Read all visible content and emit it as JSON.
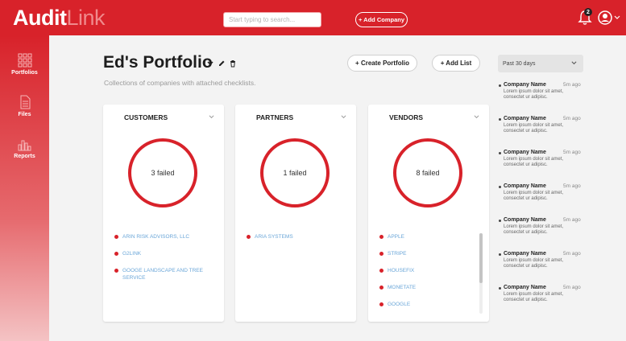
{
  "header": {
    "logo_primary": "Audit",
    "logo_secondary": "Link",
    "search_placeholder": "Start typing to search...",
    "add_company_label": "+ Add Company",
    "notification_count": "2",
    "colors": {
      "brand": "#d8222a"
    }
  },
  "sidebar": {
    "items": [
      {
        "label": "Portfolios",
        "icon": "grid-icon",
        "active": true
      },
      {
        "label": "Files",
        "icon": "document-icon"
      },
      {
        "label": "Reports",
        "icon": "bar-chart-icon"
      }
    ]
  },
  "main": {
    "title": "Ed's Portfolio",
    "subtitle": "Collections of companies with attached checklists.",
    "create_portfolio_label": "+ Create Portfolio",
    "add_list_label": "+ Add List",
    "date_range": "Past 30 days",
    "cards": [
      {
        "title": "CUSTOMERS",
        "failed": "3 failed",
        "companies": [
          "ARIN RISK ADVISORS, LLC",
          "G2LINK",
          "GOOGE LANDSCAPE AND TREE SERVICE"
        ]
      },
      {
        "title": "PARTNERS",
        "failed": "1 failed",
        "companies": [
          "ARIA SYSTEMS"
        ]
      },
      {
        "title": "VENDORS",
        "failed": "8 failed",
        "companies": [
          "APPLE",
          "STRIPE",
          "HOUSEFIX",
          "MONETATE",
          "GOOGLE"
        ]
      }
    ]
  },
  "activity": [
    {
      "name": "Company Name",
      "time": "5m ago",
      "text": "Lorem ipsum dolor sit amet, consectet ur adipisc."
    },
    {
      "name": "Company Name",
      "time": "5m ago",
      "text": "Lorem ipsum dolor sit amet, consectet ur adipisc."
    },
    {
      "name": "Company Name",
      "time": "5m ago",
      "text": "Lorem ipsum dolor sit amet, consectet ur adipisc."
    },
    {
      "name": "Company Name",
      "time": "5m ago",
      "text": "Lorem ipsum dolor sit amet, consectet ur adipisc."
    },
    {
      "name": "Company Name",
      "time": "5m ago",
      "text": "Lorem ipsum dolor sit amet, consectet ur adipisc."
    },
    {
      "name": "Company Name",
      "time": "5m ago",
      "text": "Lorem ipsum dolor sit amet, consectet ur adipisc."
    },
    {
      "name": "Company Name",
      "time": "5m ago",
      "text": "Lorem ipsum dolor sit amet, consectet ur adipisc."
    }
  ]
}
